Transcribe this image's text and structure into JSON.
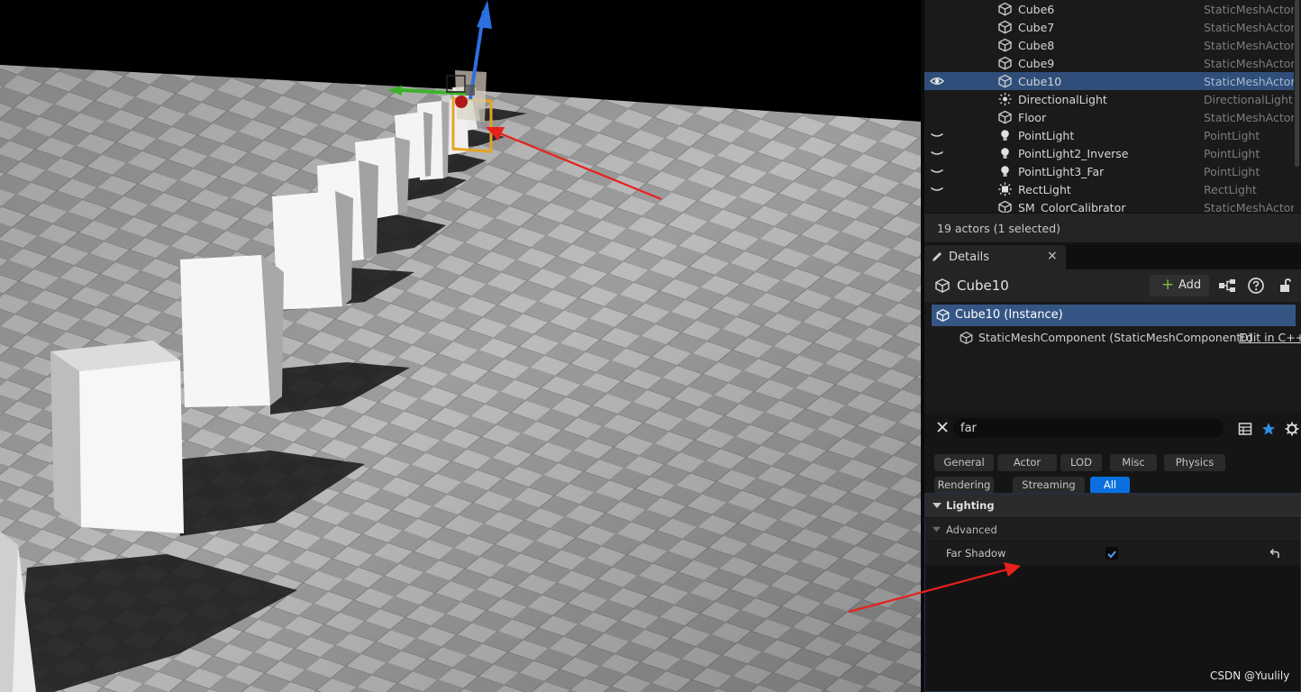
{
  "outliner": {
    "rows": [
      {
        "name": "Cube6",
        "type": "StaticMeshActor",
        "icon": "static-mesh-icon"
      },
      {
        "name": "Cube7",
        "type": "StaticMeshActor",
        "icon": "static-mesh-icon"
      },
      {
        "name": "Cube8",
        "type": "StaticMeshActor",
        "icon": "static-mesh-icon"
      },
      {
        "name": "Cube9",
        "type": "StaticMeshActor",
        "icon": "static-mesh-icon"
      },
      {
        "name": "Cube10",
        "type": "StaticMeshActor",
        "icon": "static-mesh-icon",
        "selected": true,
        "visible": true
      },
      {
        "name": "DirectionalLight",
        "type": "DirectionalLight",
        "icon": "directional-light-icon"
      },
      {
        "name": "Floor",
        "type": "StaticMeshActor",
        "icon": "static-mesh-icon"
      },
      {
        "name": "PointLight",
        "type": "PointLight",
        "icon": "point-light-icon",
        "hidden": true
      },
      {
        "name": "PointLight2_Inverse",
        "type": "PointLight",
        "icon": "point-light-icon",
        "hidden": true
      },
      {
        "name": "PointLight3_Far",
        "type": "PointLight",
        "icon": "point-light-icon",
        "hidden": true
      },
      {
        "name": "RectLight",
        "type": "RectLight",
        "icon": "rect-light-icon",
        "hidden": true
      },
      {
        "name": "SM_ColorCalibrator",
        "type": "StaticMeshActor",
        "icon": "static-mesh-icon"
      }
    ],
    "footer": "19 actors (1 selected)"
  },
  "details": {
    "tab_label": "Details",
    "tab_close": "×",
    "actor_name": "Cube10",
    "add_label": "Add",
    "add_plus": "+",
    "components": {
      "root": "Cube10 (Instance)",
      "child": "StaticMeshComponent (StaticMeshComponent0)",
      "edit_link": "Edit in C++"
    },
    "search": {
      "value": "far"
    },
    "filters": [
      {
        "label": "General",
        "active": false
      },
      {
        "label": "Actor",
        "active": false
      },
      {
        "label": "LOD",
        "active": false
      },
      {
        "label": "Misc",
        "active": false
      },
      {
        "label": "Physics",
        "active": false
      },
      {
        "label": "Rendering",
        "active": false
      },
      {
        "label": "Streaming",
        "active": false
      },
      {
        "label": "All",
        "active": true
      }
    ],
    "category": "Lighting",
    "subcategory": "Advanced",
    "property": {
      "label": "Far Shadow",
      "checked": true
    }
  },
  "colors": {
    "selection": "#2f4e7a",
    "accent_blue": "#0a70e0",
    "annotation_arrow": "#e8201c",
    "add_plus": "#7fc13c"
  },
  "watermark": "CSDN @Yuulily"
}
